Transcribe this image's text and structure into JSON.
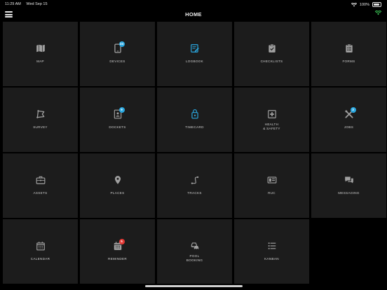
{
  "status": {
    "time": "11:29 AM",
    "date": "Wed Sep 15",
    "battery_percent": "100%"
  },
  "header": {
    "title": "HOME",
    "menu_icon": "hamburger-icon",
    "connection_icon": "wifi-icon",
    "connection_color": "#3ecf5a"
  },
  "colors": {
    "tile_background": "#1c1c1c",
    "icon_grey": "#a0a0a0",
    "logbook_blue": "#2aa8e0",
    "badge_blue": "#2aa8e0",
    "badge_red": "#e53935"
  },
  "tiles": [
    {
      "label": "MAP",
      "icon": "map-icon"
    },
    {
      "label": "DEVICES",
      "icon": "device-icon",
      "badge": "24"
    },
    {
      "label": "LOGBOOK",
      "icon": "logbook-icon"
    },
    {
      "label": "CHECKLISTS",
      "icon": "checklist-icon"
    },
    {
      "label": "FORMS",
      "icon": "forms-icon"
    },
    {
      "label": "SURVEY",
      "icon": "survey-icon"
    },
    {
      "label": "DOCKETS",
      "icon": "docket-icon",
      "badge": "9"
    },
    {
      "label": "TIMECARD",
      "icon": "timecard-icon"
    },
    {
      "label": "HEALTH\n& SAFETY",
      "icon": "health-safety-icon"
    },
    {
      "label": "JOBS",
      "icon": "jobs-icon",
      "badge": "3"
    },
    {
      "label": "ASSETS",
      "icon": "assets-icon"
    },
    {
      "label": "PLACES",
      "icon": "place-pin-icon"
    },
    {
      "label": "TRACKS",
      "icon": "tracks-icon"
    },
    {
      "label": "RUC",
      "icon": "ruc-icon"
    },
    {
      "label": "MESSAGING",
      "icon": "messaging-icon"
    },
    {
      "label": "CALENDAR",
      "icon": "calendar-icon"
    },
    {
      "label": "REMINDER",
      "icon": "reminder-icon",
      "badge": "5"
    },
    {
      "label": "POOL\nBOOKING",
      "icon": "pool-booking-icon"
    },
    {
      "label": "KANBAN",
      "icon": "kanban-icon"
    }
  ]
}
